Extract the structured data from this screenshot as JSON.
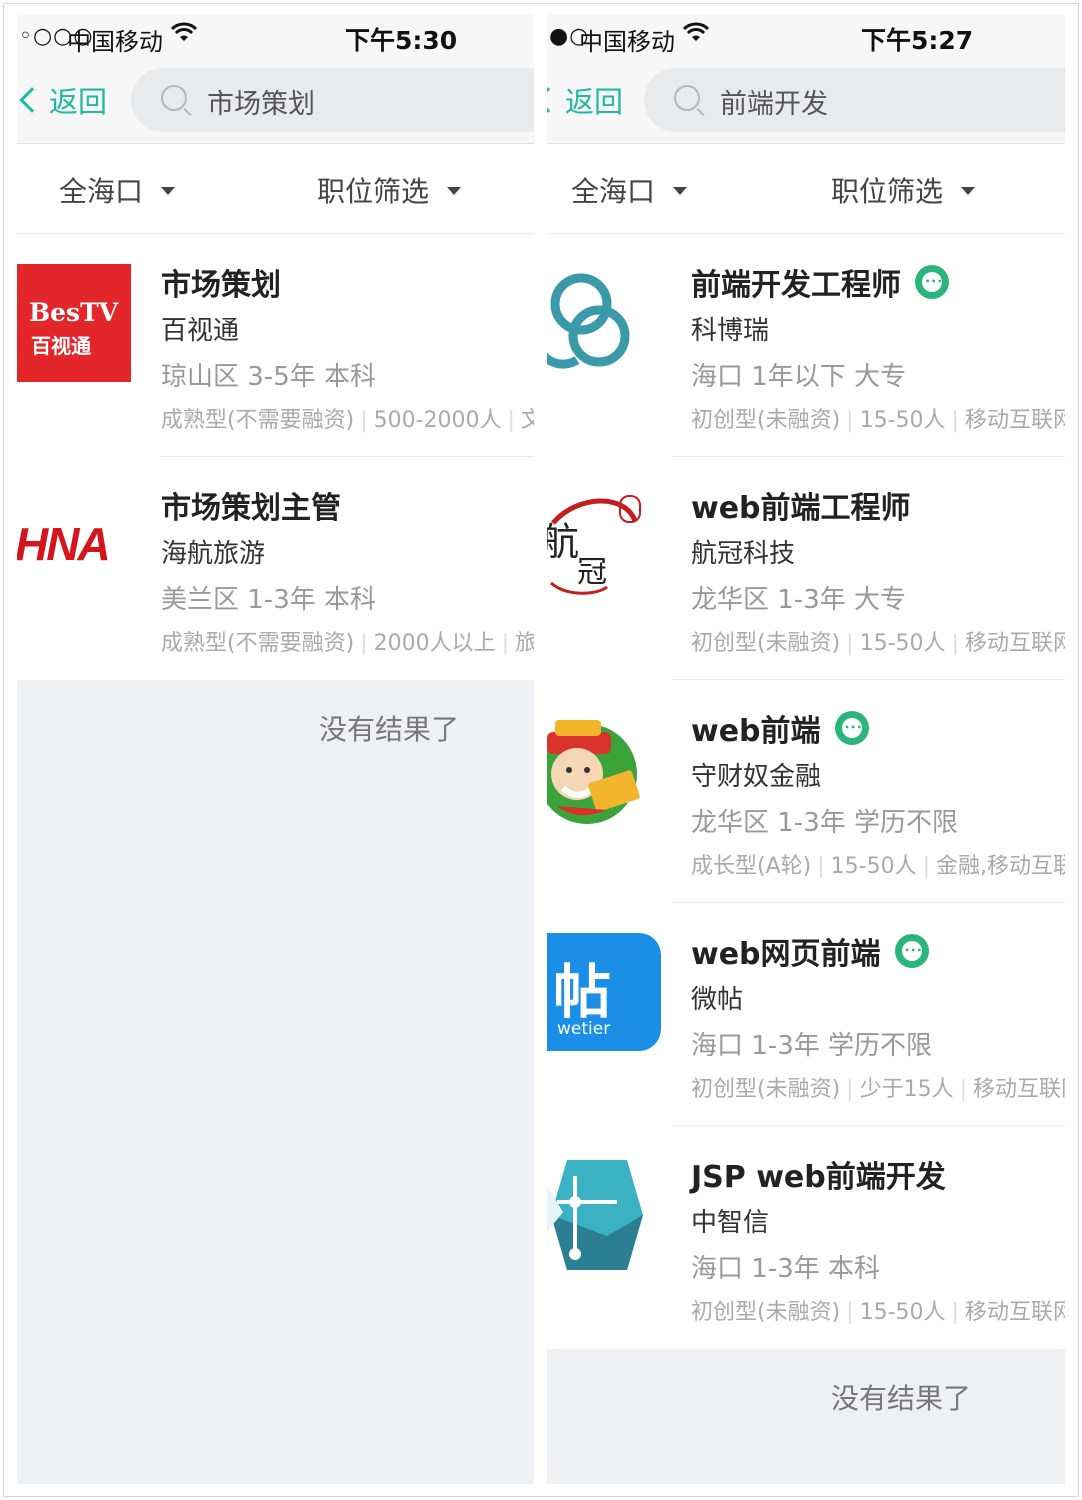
{
  "left_screen": {
    "status": {
      "signal": "◦○○○",
      "carrier": "中国移动",
      "time": "下午5:30"
    },
    "nav": {
      "back_label": "返回",
      "search_query": "市场策划"
    },
    "filters": {
      "location": "全海口",
      "position_filter": "职位筛选"
    },
    "jobs": [
      {
        "title": "市场策划",
        "company": "百视通",
        "meta": "琼山区  3-5年  本科",
        "info": [
          "成熟型(不需要融资)",
          "500-2000人",
          "文化传媒"
        ],
        "logo": {
          "brand": "BesTV",
          "sub": "百视通",
          "color": "#e3262a"
        },
        "chat_badge": false
      },
      {
        "title": "市场策划主管",
        "company": "海航旅游",
        "meta": "美兰区  1-3年  本科",
        "info": [
          "成熟型(不需要融资)",
          "2000人以上",
          "旅游"
        ],
        "logo": {
          "brand": "HNA",
          "color": "#d4151b"
        },
        "chat_badge": false
      }
    ],
    "end_text": "没有结果了"
  },
  "right_screen": {
    "status": {
      "signal": "●○",
      "carrier": "中国移动",
      "time": "下午5:27"
    },
    "nav": {
      "back_label": "返回",
      "search_query": "前端开发"
    },
    "filters": {
      "location": "全海口",
      "position_filter": "职位筛选"
    },
    "jobs": [
      {
        "title": "前端开发工程师",
        "company": "科博瑞",
        "meta": "海口  1年以下  大专",
        "info": [
          "初创型(未融资)",
          "15-50人",
          "移动互联网"
        ],
        "logo": {
          "icon": "cloud-logo-icon",
          "color": "#3a9aa9"
        },
        "chat_badge": true
      },
      {
        "title": "web前端工程师",
        "company": "航冠科技",
        "meta": "龙华区  1-3年  大专",
        "info": [
          "初创型(未融资)",
          "15-50人",
          "移动互联网"
        ],
        "logo": {
          "text1": "航",
          "text2": "冠",
          "color": "#c41e1e"
        },
        "chat_badge": false
      },
      {
        "title": "web前端",
        "company": "守财奴金融",
        "meta": "龙华区  1-3年  学历不限",
        "info": [
          "成长型(A轮)",
          "15-50人",
          "金融,移动互联网"
        ],
        "logo": {
          "icon": "cartoon-mascot-icon",
          "color": "#3aa33a"
        },
        "chat_badge": true
      },
      {
        "title": "web网页前端",
        "company": "微帖",
        "meta": "海口  1-3年  学历不限",
        "info": [
          "初创型(未融资)",
          "少于15人",
          "移动互联网"
        ],
        "logo": {
          "brand": "帖",
          "sub": "wetier",
          "color": "#1b8fe8"
        },
        "chat_badge": true
      },
      {
        "title": "JSP web前端开发",
        "company": "中智信",
        "meta": "海口  1-3年  本科",
        "info": [
          "初创型(未融资)",
          "15-50人",
          "移动互联网"
        ],
        "logo": {
          "icon": "hexagon-logo-icon",
          "color": "#3bb1c4"
        },
        "chat_badge": false
      }
    ],
    "end_text": "没有结果了"
  }
}
